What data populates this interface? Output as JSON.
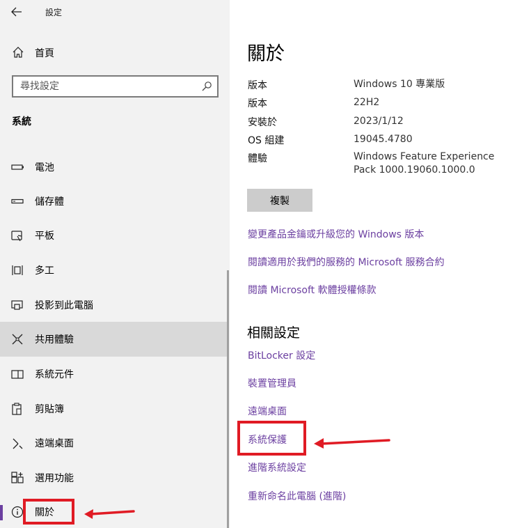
{
  "app": {
    "title": "設定"
  },
  "sidebar": {
    "home_label": "首頁",
    "search_placeholder": "尋找設定",
    "section_title": "系統",
    "items": [
      {
        "label": "電池",
        "icon": "battery-icon"
      },
      {
        "label": "儲存體",
        "icon": "storage-icon"
      },
      {
        "label": "平板",
        "icon": "tablet-icon"
      },
      {
        "label": "多工",
        "icon": "multitasking-icon"
      },
      {
        "label": "投影到此電腦",
        "icon": "project-icon"
      },
      {
        "label": "共用體驗",
        "icon": "shared-experiences-icon"
      },
      {
        "label": "系統元件",
        "icon": "system-components-icon"
      },
      {
        "label": "剪貼簿",
        "icon": "clipboard-icon"
      },
      {
        "label": "遠端桌面",
        "icon": "remote-desktop-icon"
      },
      {
        "label": "選用功能",
        "icon": "optional-features-icon"
      },
      {
        "label": "關於",
        "icon": "info-icon"
      }
    ]
  },
  "main": {
    "title": "關於",
    "specs": [
      {
        "label": "版本",
        "value": "Windows 10 專業版"
      },
      {
        "label": "版本",
        "value": "22H2"
      },
      {
        "label": "安裝於",
        "value": "2023/1/12"
      },
      {
        "label": "OS 組建",
        "value": "19045.4780"
      },
      {
        "label": "體驗",
        "value": "Windows Feature Experience Pack 1000.19060.1000.0"
      }
    ],
    "copy_label": "複製",
    "links": [
      "變更產品金鑰或升級您的 Windows 版本",
      "閱讀適用於我們的服務的 Microsoft 服務合約",
      "閱讀 Microsoft 軟體授權條款"
    ],
    "related_title": "相關設定",
    "related_links": [
      "BitLocker 設定",
      "裝置管理員",
      "遠端桌面",
      "系統保護",
      "進階系統設定",
      "重新命名此電腦 (進階)"
    ]
  },
  "colors": {
    "accent": "#6b3fa0",
    "annotation": "#e01b24",
    "sidebar_bg": "#f2f2f2",
    "active_bg": "#d9d9d9"
  }
}
